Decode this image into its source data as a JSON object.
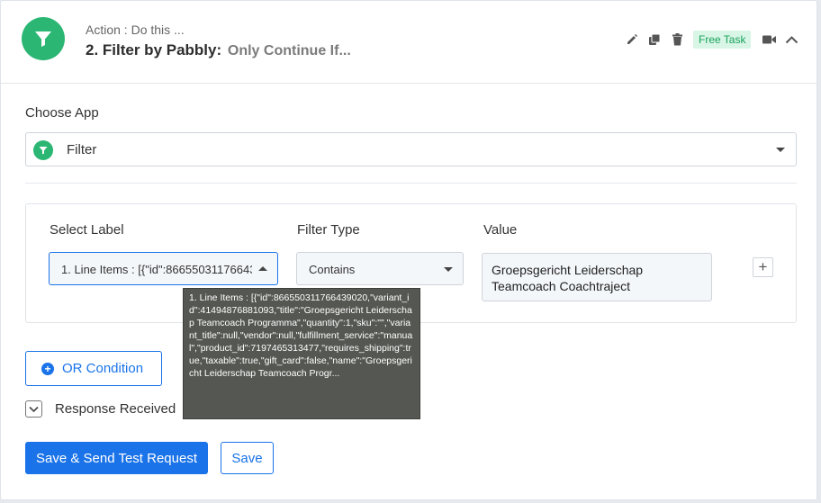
{
  "header": {
    "action_label": "Action : Do this ...",
    "title": "2. Filter by Pabbly:",
    "subtitle": "Only Continue If...",
    "free_task": "Free Task"
  },
  "choose_app": {
    "label": "Choose App",
    "selected": "Filter"
  },
  "filter": {
    "select_label_heading": "Select Label",
    "filter_type_heading": "Filter Type",
    "value_heading": "Value",
    "select_label_value": "1. Line Items : [{\"id\":866550311766439020",
    "filter_type_value": "Contains",
    "value_text": "Groepsgericht Leiderschap Teamcoach Coachtraject"
  },
  "tooltip": {
    "text": "1. Line Items : [{\"id\":866550311766439020,\"variant_id\":41494876881093,\"title\":\"Groepsgericht Leiderschap Teamcoach Programma\",\"quantity\":1,\"sku\":\"\",\"variant_title\":null,\"vendor\":null,\"fulfillment_service\":\"manual\",\"product_id\":7197465313477,\"requires_shipping\":true,\"taxable\":true,\"gift_card\":false,\"name\":\"Groepsgericht Leiderschap Teamcoach Progr..."
  },
  "or_condition": "OR Condition",
  "response_received": "Response Received",
  "buttons": {
    "save_send": "Save & Send Test Request",
    "save": "Save"
  },
  "colors": {
    "accent": "#1a73e8",
    "brand_green": "#2bb673",
    "free_task_bg": "#d8f5e6"
  }
}
